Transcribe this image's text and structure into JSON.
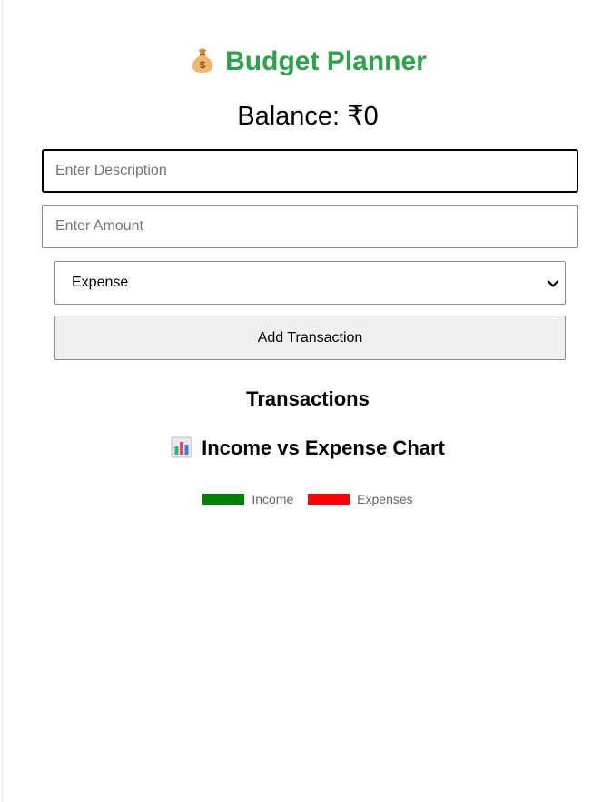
{
  "app": {
    "title": "Budget Planner",
    "title_icon": "money-bag-icon",
    "title_color": "#2ea24a"
  },
  "balance": {
    "text": "Balance: ₹0"
  },
  "form": {
    "description": {
      "value": "",
      "placeholder": "Enter Description"
    },
    "amount": {
      "value": "",
      "placeholder": "Enter Amount"
    },
    "type_select": {
      "selected": "Expense"
    },
    "submit_label": "Add Transaction"
  },
  "transactions": {
    "heading": "Transactions",
    "items": []
  },
  "chart": {
    "heading": "Income vs Expense Chart",
    "heading_icon": "bar-chart-icon",
    "legend": [
      {
        "label": "Income",
        "color": "#008000"
      },
      {
        "label": "Expenses",
        "color": "#ff0000"
      }
    ]
  },
  "chart_data": {
    "type": "bar",
    "title": "",
    "categories": [],
    "series": [
      {
        "name": "Income",
        "values": [],
        "color": "#008000"
      },
      {
        "name": "Expenses",
        "values": [],
        "color": "#ff0000"
      }
    ]
  }
}
